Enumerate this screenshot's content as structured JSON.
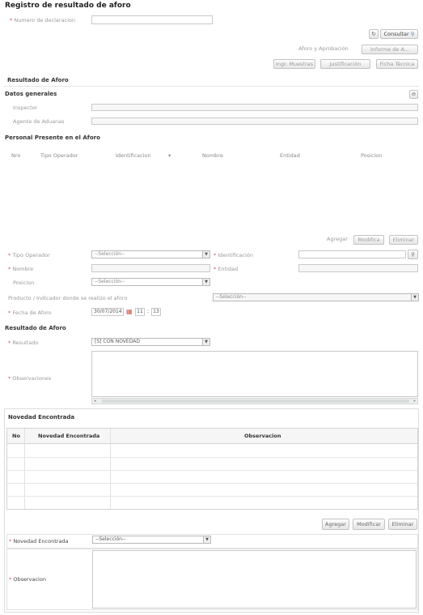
{
  "page": {
    "title": "Registro de resultado de aforo"
  },
  "declaration": {
    "label": "Numero de declaracion",
    "value": ""
  },
  "toolbar": {
    "refresh_icon": "refresh-icon",
    "consultar_label": "Consultar",
    "aforo_aprobacion_label": "Aforo y Aprobación",
    "informe_label": "Informe de A...",
    "ingr_muestras_label": "Ingr. Muestras",
    "justificacion_label": "Justificación",
    "ficha_tecnica_label": "Ficha Técnica"
  },
  "resultado": {
    "heading": "Resultado de Aforo"
  },
  "datos_generales": {
    "heading": "Datos generales",
    "inspector_label": "Inspector",
    "agente_label": "Agente de Aduanas"
  },
  "personal": {
    "heading": "Personal Presente en el Aforo",
    "columns": [
      "Nro",
      "Tipo Operador",
      "Identificacion",
      "Nombre",
      "Entidad",
      "Posicion"
    ],
    "agregar_label": "Agregar",
    "modificar_label": "Modifica",
    "eliminar_label": "Eliminar"
  },
  "form": {
    "tipo_operador_label": "Tipo Operador",
    "tipo_operador_value": "--Selección--",
    "identificacion_label": "Identificación",
    "nombre_label": "Nombre",
    "entidad_label": "Entidad",
    "posicion_label": "Posicion",
    "posicion_value": "--Selección--",
    "producto_label": "Producto / Indicador donde se realizo el aforo",
    "producto_value": "--Selección--",
    "fecha_label": "Fecha de Aforo",
    "fecha_value": "30/07/2014",
    "hora_value": "11",
    "minuto_value": "13"
  },
  "resultado_aforo": {
    "heading": "Resultado de Aforo",
    "resultado_label": "Resultado",
    "resultado_value": "[S] CON NOVEDAD",
    "observaciones_label": "Observaciones"
  },
  "novedad": {
    "heading": "Novedad Encontrada",
    "col_no": "No",
    "col_novedad": "Novedad Encontrada",
    "col_obs": "Observacion",
    "agregar_label": "Agregar",
    "modificar_label": "Modificar",
    "eliminar_label": "Eliminar",
    "novedad_label": "Novedad Encontrada",
    "novedad_value": "--Selección--",
    "observacion_label": "Observacion"
  },
  "colors": {
    "required": "#d9534f",
    "border": "#c9c9c9"
  }
}
